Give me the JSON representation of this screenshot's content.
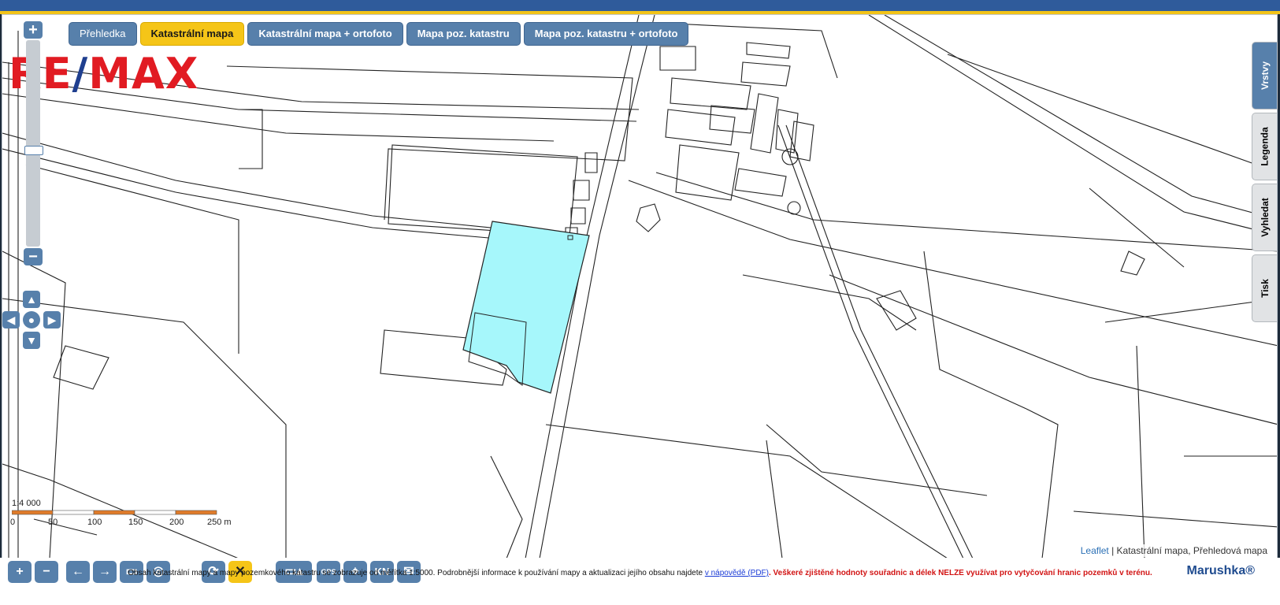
{
  "tabs": [
    {
      "label": "Přehledka",
      "active": false
    },
    {
      "label": "Katastrální mapa",
      "active": true
    },
    {
      "label": "Katastrální mapa + ortofoto",
      "active": false
    },
    {
      "label": "Mapa poz. katastru",
      "active": false
    },
    {
      "label": "Mapa poz. katastru + ortofoto",
      "active": false
    }
  ],
  "logo": {
    "left": "RE",
    "slash": "/",
    "right": "MAX"
  },
  "zoom": {
    "plus": "+",
    "minus": "−",
    "level_fraction": 0.47
  },
  "side_tabs": [
    "Vrstvy",
    "Legenda",
    "Vyhledat",
    "Tisk"
  ],
  "scale": {
    "ratio": "1:4 000",
    "ticks": [
      "0",
      "50",
      "100",
      "150",
      "200",
      "250 m"
    ]
  },
  "attribution": {
    "link": "Leaflet",
    "separator": " | ",
    "text": "Katastrální mapa, Přehledová mapa"
  },
  "toolbar_icons": [
    "zoom-in-icon",
    "zoom-out-icon",
    "back-icon",
    "forward-icon",
    "zoom-box-icon",
    "globe-icon",
    "refresh-icon",
    "close-icon",
    "measure-icon",
    "gps-icon",
    "locate-icon",
    "kn-icon",
    "feedback-icon"
  ],
  "toolbar_labels": {
    "kn": "KN",
    "gps": "GPS"
  },
  "brand": "Marushka®",
  "footer": {
    "text": "Obsah katastrální mapy a mapy pozemkového katastru se zobrazuje od měřítka 1:5000. Podrobnější informace k používání mapy a aktualizaci jejího obsahu najdete",
    "link": "v nápovědě (PDF)",
    "warning": ". Veškeré zjištěné hodnoty souřadnic a délek NELZE využívat pro vytyčování hranic pozemků v terénu."
  },
  "colors": {
    "highlight_parcel": "#a6f7fb",
    "accent": "#f5c518",
    "button": "#5780ab"
  }
}
